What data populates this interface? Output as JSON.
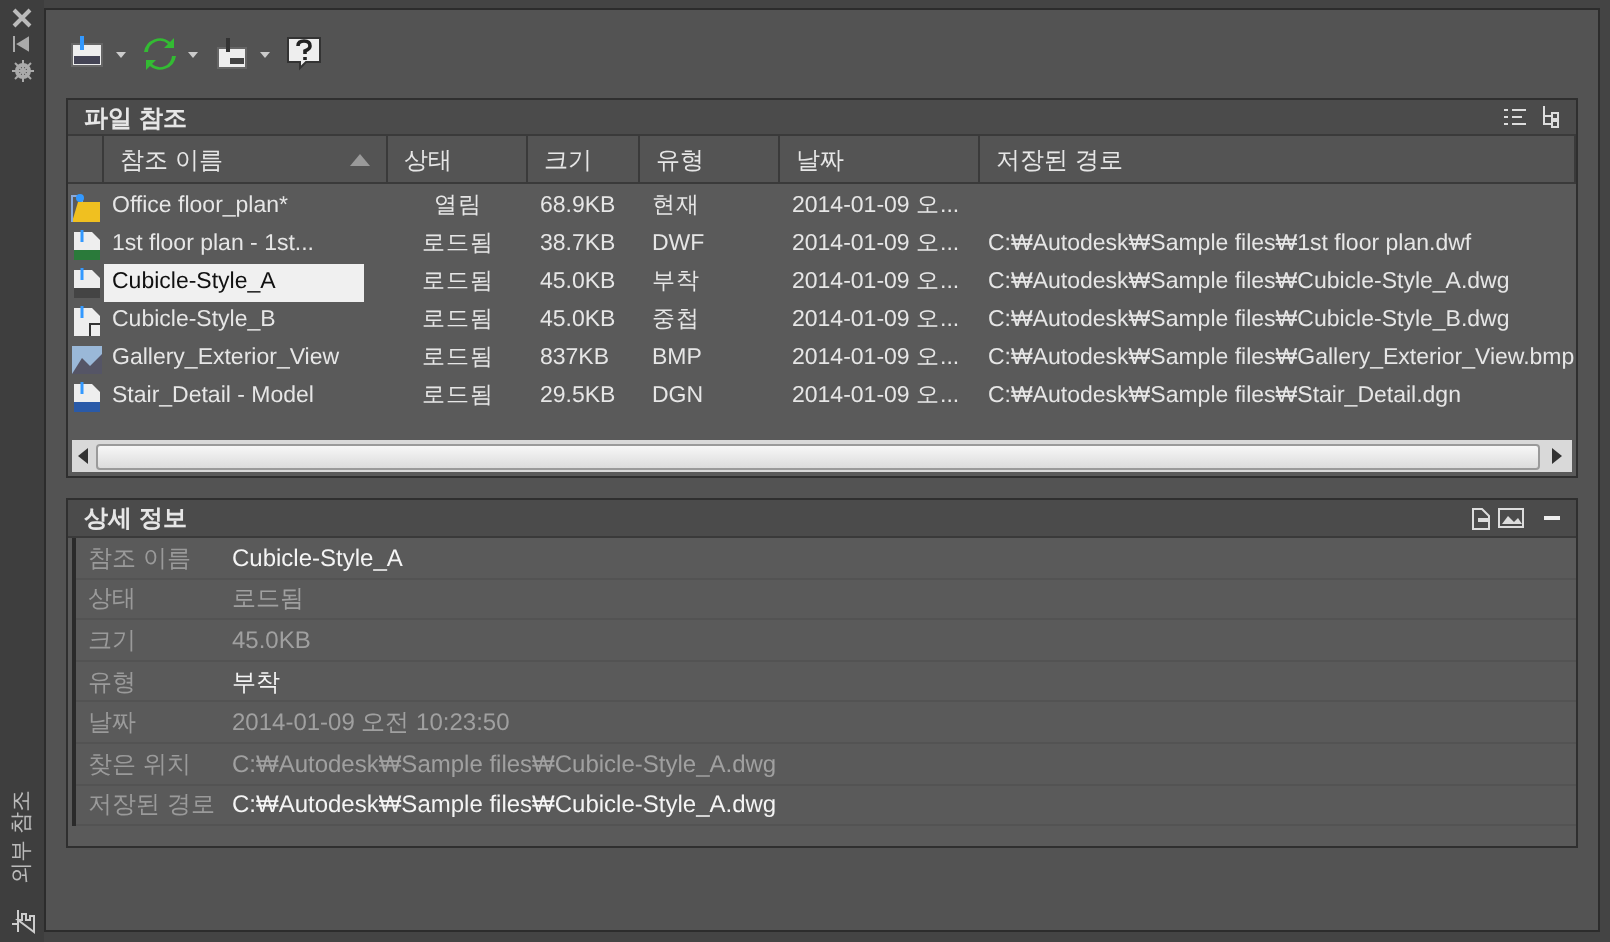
{
  "side_bar": {
    "title": "외부 참조"
  },
  "toolbar": [
    {
      "kind": "attach",
      "has_menu": true
    },
    {
      "kind": "refresh",
      "has_menu": true
    },
    {
      "kind": "change-path",
      "has_menu": true
    },
    {
      "kind": "help",
      "has_menu": false
    }
  ],
  "file_references": {
    "title": "파일 참조",
    "columns": [
      {
        "label": "참조 이름",
        "sorted": true
      },
      {
        "label": "상태",
        "sorted": false
      },
      {
        "label": "크기",
        "sorted": false
      },
      {
        "label": "유형",
        "sorted": false
      },
      {
        "label": "날짜",
        "sorted": false
      },
      {
        "label": "저장된 경로",
        "sorted": false
      }
    ],
    "rows": [
      {
        "kind": "drawing",
        "name": "Office floor_plan*",
        "status": "열림",
        "size": "68.9KB",
        "type": "현재",
        "date": "2014-01-09 오...",
        "path": "",
        "selected": false
      },
      {
        "kind": "dwf",
        "name": "1st floor plan - 1st...",
        "status": "로드됨",
        "size": "38.7KB",
        "type": "DWF",
        "date": "2014-01-09 오...",
        "path": "C:₩Autodesk₩Sample files₩1st floor plan.dwf",
        "selected": false
      },
      {
        "kind": "dwg",
        "name": "Cubicle-Style_A",
        "status": "로드됨",
        "size": "45.0KB",
        "type": "부착",
        "date": "2014-01-09 오...",
        "path": "C:₩Autodesk₩Sample files₩Cubicle-Style_A.dwg",
        "selected": true
      },
      {
        "kind": "overlay",
        "name": "Cubicle-Style_B",
        "status": "로드됨",
        "size": "45.0KB",
        "type": "중첩",
        "date": "2014-01-09 오...",
        "path": "C:₩Autodesk₩Sample files₩Cubicle-Style_B.dwg",
        "selected": false
      },
      {
        "kind": "image",
        "name": "Gallery_Exterior_View",
        "status": "로드됨",
        "size": "837KB",
        "type": "BMP",
        "date": "2014-01-09 오...",
        "path": "C:₩Autodesk₩Sample files₩Gallery_Exterior_View.bmp",
        "selected": false
      },
      {
        "kind": "dgn",
        "name": "Stair_Detail - Model",
        "status": "로드됨",
        "size": "29.5KB",
        "type": "DGN",
        "date": "2014-01-09 오...",
        "path": "C:₩Autodesk₩Sample files₩Stair_Detail.dgn",
        "selected": false
      }
    ]
  },
  "details": {
    "title": "상세 정보",
    "fields": [
      {
        "label": "참조 이름",
        "value": "Cubicle-Style_A",
        "editable": true
      },
      {
        "label": "상태",
        "value": "로드됨",
        "editable": false
      },
      {
        "label": "크기",
        "value": "45.0KB",
        "editable": false
      },
      {
        "label": "유형",
        "value": "부착",
        "editable": true
      },
      {
        "label": "날짜",
        "value": "2014-01-09 오전 10:23:50",
        "editable": false
      },
      {
        "label": "찾은 위치",
        "value": "C:₩Autodesk₩Sample files₩Cubicle-Style_A.dwg",
        "editable": false
      },
      {
        "label": "저장된 경로",
        "value": "C:₩Autodesk₩Sample files₩Cubicle-Style_A.dwg",
        "editable": true
      }
    ]
  }
}
